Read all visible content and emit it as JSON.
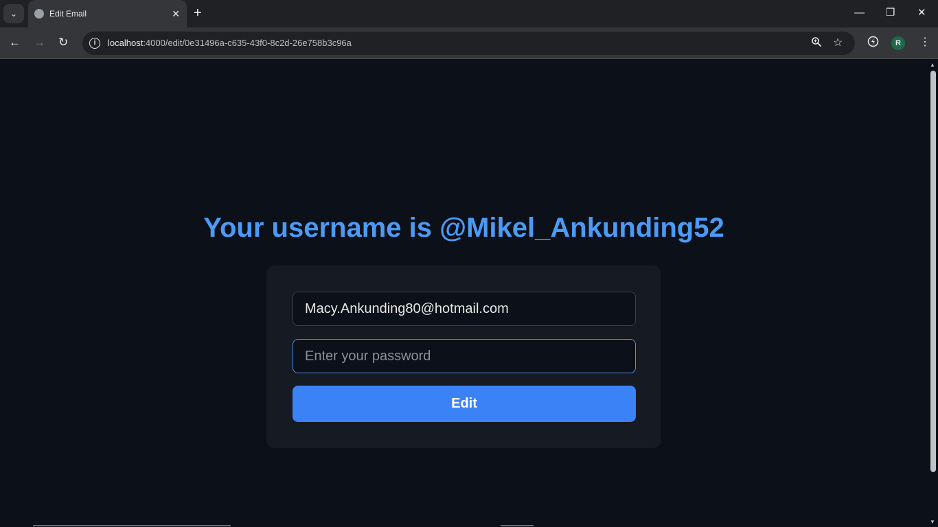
{
  "browser": {
    "tab_title": "Edit Email",
    "tab_close": "✕",
    "new_tab": "+",
    "url_host": "localhost",
    "url_rest": ":4000/edit/0e31496a-c635-43f0-8c2d-26e758b3c96a",
    "profile_initial": "R",
    "icons": {
      "tab_search": "chevron-down-icon",
      "back": "arrow-left-icon",
      "forward": "arrow-right-icon",
      "reload": "reload-icon",
      "site_info": "info-icon",
      "zoom": "zoom-icon",
      "bookmark": "star-icon",
      "extension": "extension-icon",
      "menu": "more-vert-icon",
      "minimize": "minimize-icon",
      "restore": "restore-icon",
      "close": "close-icon"
    }
  },
  "page": {
    "heading": "Your username is @Mikel_Ankunding52",
    "email_value": "Macy.Ankunding80@hotmail.com",
    "password_placeholder": "Enter your password",
    "edit_label": "Edit"
  },
  "colors": {
    "background": "#0c1018",
    "card": "#161b23",
    "heading": "#4b9bf6",
    "button": "#3b82f6"
  }
}
